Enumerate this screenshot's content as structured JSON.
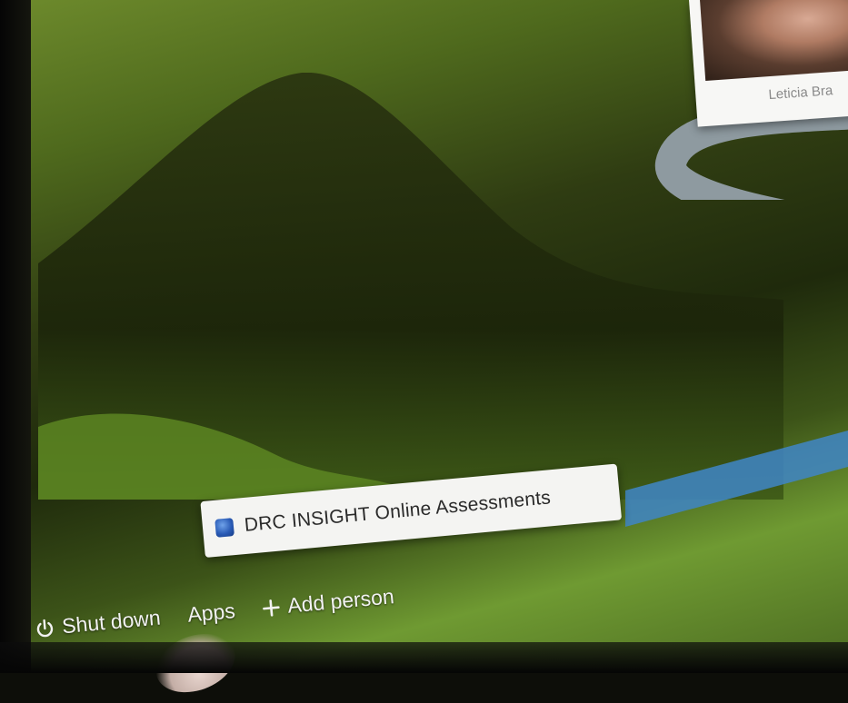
{
  "popup": {
    "app_name": "DRC INSIGHT Online Assessments",
    "icon": "drc-app-icon"
  },
  "shelf": {
    "shutdown_label": "Shut down",
    "shutdown_icon": "power-icon",
    "apps_label": "Apps",
    "add_person_label": "Add person",
    "add_person_icon": "plus-icon"
  },
  "user_pod": {
    "name": "Leticia Bra"
  },
  "colors": {
    "popup_bg": "#f4f4f2",
    "shelf_text": "#f2f2f2",
    "app_icon_blue": "#2a5bb6"
  }
}
